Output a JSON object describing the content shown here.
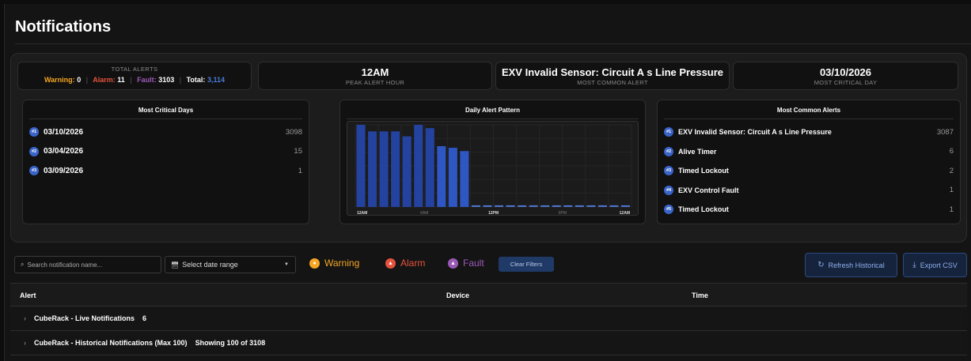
{
  "page": {
    "title": "Notifications"
  },
  "stats": {
    "total_alerts": {
      "title": "TOTAL ALERTS",
      "warning_label": "Warning:",
      "warning_value": "0",
      "alarm_label": "Alarm:",
      "alarm_value": "11",
      "fault_label": "Fault:",
      "fault_value": "3103",
      "total_label": "Total:",
      "total_value": "3,114",
      "separator": "|"
    },
    "peak_hour": {
      "value": "12AM",
      "label": "PEAK ALERT HOUR"
    },
    "common_alert": {
      "value": "EXV Invalid Sensor: Circuit A s Line Pressure",
      "label": "MOST COMMON ALERT"
    },
    "critical_day": {
      "value": "03/10/2026",
      "label": "MOST CRITICAL DAY"
    }
  },
  "critical_days": {
    "title": "Most Critical Days",
    "items": [
      {
        "rank": "#1",
        "date": "03/10/2026",
        "count": "3098"
      },
      {
        "rank": "#2",
        "date": "03/04/2026",
        "count": "15"
      },
      {
        "rank": "#3",
        "date": "03/09/2026",
        "count": "1"
      }
    ]
  },
  "daily_pattern": {
    "title": "Daily Alert Pattern",
    "x_ticks": [
      "12AM",
      "6AM",
      "12PM",
      "6PM",
      "12AM"
    ]
  },
  "chart_data": {
    "type": "bar",
    "title": "Daily Alert Pattern",
    "categories": [
      "0",
      "1",
      "2",
      "3",
      "4",
      "5",
      "6",
      "7",
      "8",
      "9",
      "10",
      "11",
      "12",
      "13",
      "14",
      "15",
      "16",
      "17",
      "18",
      "19",
      "20",
      "21",
      "22",
      "23"
    ],
    "values": [
      100,
      92,
      92,
      92,
      86,
      100,
      96,
      74,
      72,
      68,
      2,
      2,
      2,
      2,
      2,
      2,
      2,
      2,
      2,
      2,
      2,
      2,
      2,
      2
    ],
    "x_tick_labels": [
      "12AM",
      "6AM",
      "12PM",
      "6PM",
      "12AM"
    ],
    "ylim": [
      0,
      100
    ],
    "grid": true
  },
  "common_alerts": {
    "title": "Most Common Alerts",
    "items": [
      {
        "rank": "#1",
        "name": "EXV Invalid Sensor: Circuit A s Line Pressure",
        "count": "3087"
      },
      {
        "rank": "#2",
        "name": "Alive Timer",
        "count": "6"
      },
      {
        "rank": "#3",
        "name": "Timed Lockout",
        "count": "2"
      },
      {
        "rank": "#4",
        "name": "EXV Control Fault",
        "count": "1"
      },
      {
        "rank": "#5",
        "name": "Timed Lockout",
        "count": "1"
      }
    ]
  },
  "filters": {
    "search_placeholder": "Search notification name...",
    "search_icon": "magnifier-icon",
    "date_range": "Select date range",
    "date_icon": "calendar-icon",
    "warning": "Warning",
    "alarm": "Alarm",
    "fault": "Fault",
    "clear": "Clear Filters",
    "refresh": "Refresh Historical",
    "export": "Export CSV",
    "colors": {
      "warning": "#f5a623",
      "alarm": "#e5533d",
      "fault": "#9b59b6",
      "accent": "#3a64c8"
    }
  },
  "table": {
    "columns": [
      "Alert",
      "Device",
      "Time"
    ],
    "groups": [
      {
        "name": "CubeRack - Live Notifications",
        "extra": "6"
      },
      {
        "name": "CubeRack - Historical Notifications (Max 100)",
        "extra": "Showing 100 of 3108"
      }
    ]
  }
}
